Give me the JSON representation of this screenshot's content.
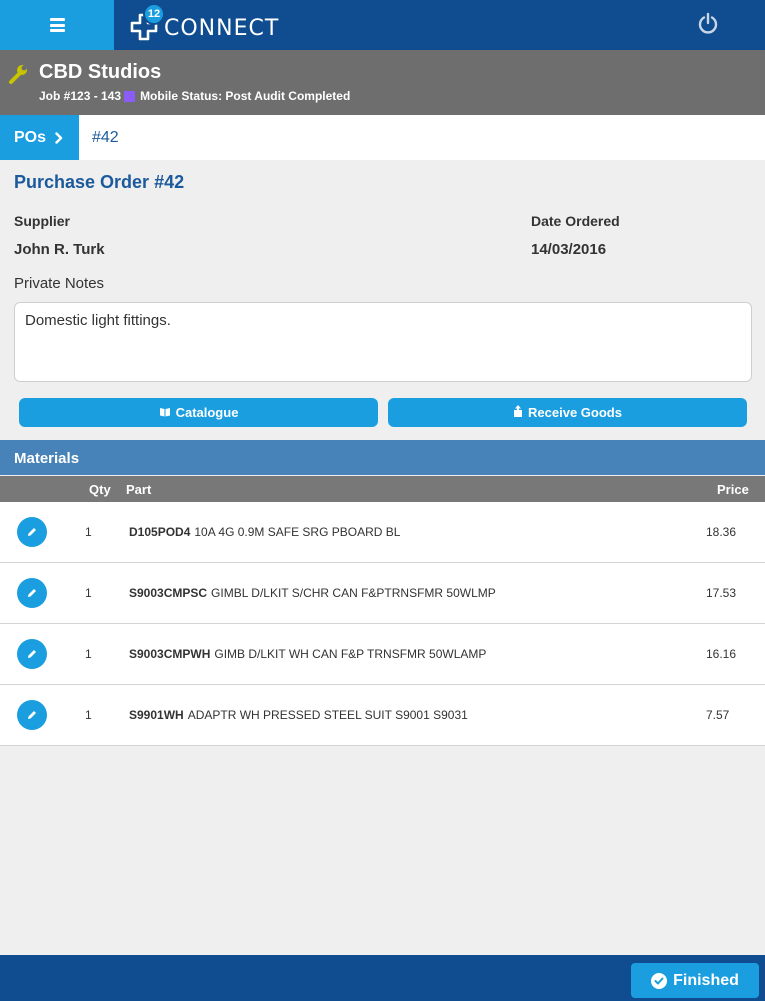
{
  "header": {
    "menu_icon": "hamburger-icon",
    "badge_count": "12",
    "logo_text": "CONNECT",
    "power_icon": "power-icon",
    "colors": {
      "bar": "#0f4d90",
      "accent": "#1a9ee0"
    }
  },
  "job": {
    "client": "CBD Studios",
    "job_number": "Job #123 - 143",
    "status_text": "Mobile Status: Post Audit Completed",
    "status_color": "#8b5cf6"
  },
  "breadcrumb": {
    "parent": "POs",
    "current": "#42"
  },
  "po": {
    "title": "Purchase Order #42",
    "supplier_label": "Supplier",
    "supplier_value": "John R. Turk",
    "date_label": "Date Ordered",
    "date_value": "14/03/2016",
    "notes_label": "Private Notes",
    "notes_value": "Domestic light fittings."
  },
  "actions": {
    "catalogue": "Catalogue",
    "receive": "Receive Goods"
  },
  "materials": {
    "title": "Materials",
    "columns": {
      "qty": "Qty",
      "part": "Part",
      "price": "Price"
    },
    "rows": [
      {
        "qty": "1",
        "code": "D105POD4",
        "desc": "10A 4G 0.9M SAFE SRG PBOARD BL",
        "price": "18.36"
      },
      {
        "qty": "1",
        "code": "S9003CMPSC",
        "desc": "GIMBL D/LKIT S/CHR CAN F&PTRNSFMR 50WLMP",
        "price": "17.53"
      },
      {
        "qty": "1",
        "code": "S9003CMPWH",
        "desc": "GIMB D/LKIT WH CAN F&P TRNSFMR 50WLAMP",
        "price": "16.16"
      },
      {
        "qty": "1",
        "code": "S9901WH",
        "desc": "ADAPTR WH PRESSED STEEL SUIT S9001 S9031",
        "price": "7.57"
      }
    ]
  },
  "footer": {
    "finished": "Finished"
  }
}
